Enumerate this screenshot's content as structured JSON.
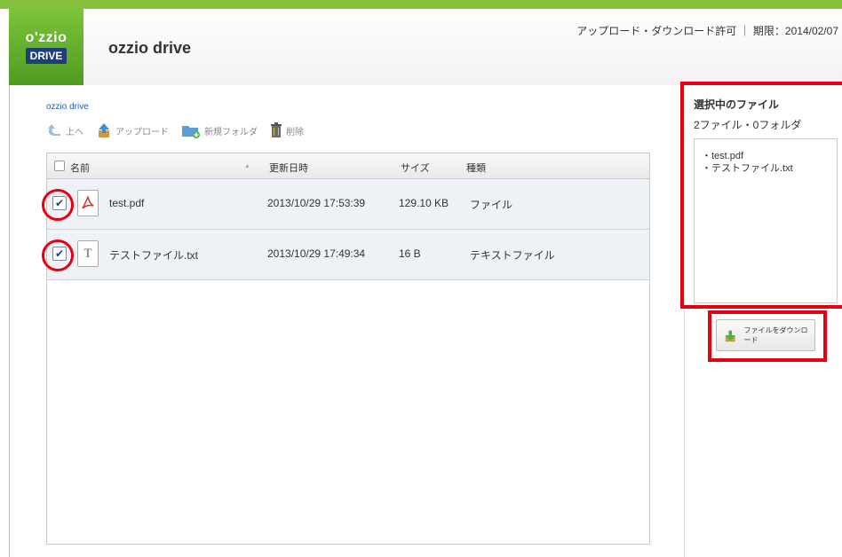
{
  "header": {
    "logo_line1": "o'zzio",
    "logo_line2": "DRIVE",
    "title": "ozzio drive",
    "permission": "アップロード・ダウンロード許可 ｜ 期限：2014/02/07"
  },
  "breadcrumb": "ozzio drive",
  "toolbar": {
    "up": "上へ",
    "upload": "アップロード",
    "new_folder": "新規フォルダ",
    "delete": "削除"
  },
  "table": {
    "headers": {
      "name": "名前",
      "sort": "▲",
      "modified": "更新日時",
      "size": "サイズ",
      "type": "種類"
    },
    "rows": [
      {
        "checked": "✔",
        "icon": "pdf-icon",
        "name": "test.pdf",
        "modified": "2013/10/29 17:53:39",
        "size": "129.10 KB",
        "type": "ファイル"
      },
      {
        "checked": "✔",
        "icon": "text-file-icon",
        "name": "テストファイル.txt",
        "modified": "2013/10/29 17:49:34",
        "size": "16 B",
        "type": "テキストファイル"
      }
    ]
  },
  "selection": {
    "title": "選択中のファイル",
    "count": "2ファイル・0フォルダ",
    "items": [
      "・test.pdf",
      "・テストファイル.txt"
    ],
    "download_label": "ファイルをダウンロード"
  },
  "colors": {
    "accent_green": "#86c13b",
    "highlight_red": "#e60012",
    "link_blue": "#2b5fa8"
  }
}
